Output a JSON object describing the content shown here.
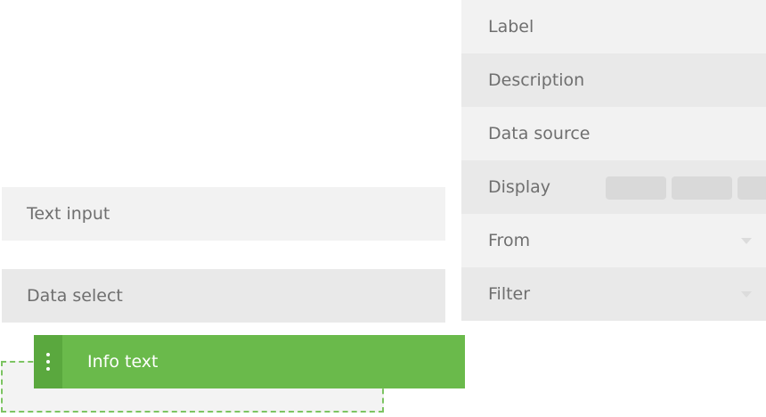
{
  "palette": {
    "text_input_label": "Text input",
    "data_select_label": "Data select"
  },
  "dragging": {
    "label": "Info text"
  },
  "properties": {
    "label": "Label",
    "description": "Description",
    "data_source": "Data source",
    "display": "Display",
    "from": "From",
    "filter": "Filter"
  },
  "colors": {
    "accent": "#6aba4b",
    "accent_dark": "#5aa83e",
    "drop_outline": "#7cc462",
    "row_light": "#f2f2f2",
    "row_dark": "#e9e9e9",
    "text": "#6f6f6f"
  },
  "icons": {
    "drag_handle": "vertical-dots-icon",
    "dropdown": "caret-down-icon"
  }
}
